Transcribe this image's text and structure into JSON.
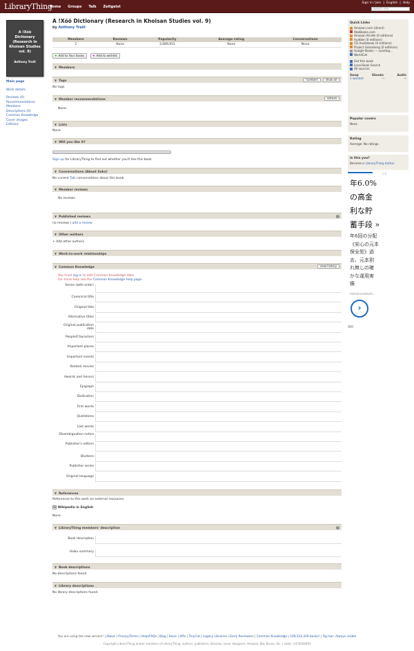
{
  "header": {
    "logo": "LibraryThing",
    "nav": [
      "Home",
      "Groups",
      "Talk",
      "Zeitgeist"
    ],
    "links": [
      "Sign in / Join",
      "English",
      "Help"
    ],
    "search_placeholder": "Search site"
  },
  "cover": {
    "title": "A !Xóõ Dictionary (Research in Khoisan Studies vol. 9)",
    "author": "Anthony Traill"
  },
  "leftnav": {
    "main_page": "Main page",
    "work_details": "Work details",
    "reviews": "Reviews (0)",
    "recommendations": "Recommendations",
    "members": "Members",
    "descriptions": "Descriptions (0)",
    "common_knowledge": "Common Knowledge",
    "cover_images": "Cover images",
    "editions": "Editions"
  },
  "book": {
    "title": "A !Xóõ Dictionary (Research in Khoisan Studies vol. 9)",
    "by": "by",
    "author": "Anthony Traill"
  },
  "stats": {
    "headers": [
      "Members",
      "Reviews",
      "Popularity",
      "Average rating",
      "Conversations"
    ],
    "values": [
      "1",
      "None",
      "3,689,951",
      "None",
      "None"
    ]
  },
  "buttons": {
    "add_books": "Add to Your books",
    "add_wishlist": "Add to wishlist"
  },
  "sections": {
    "members": "Members",
    "tags": "Tags",
    "tags_numbers": "numbers",
    "tags_show_all": "show all",
    "no_tags": "No tags.",
    "member_recs": "Member recommendations",
    "refresh": "refresh",
    "none": "None.",
    "lists": "Lists",
    "lists_none": "None",
    "will_you_like": "Will you like it?",
    "signup_link": "Sign up",
    "signup_text": "for LibraryThing to find out whether you'll like this book.",
    "conversations": "Conversations (About links)",
    "conv_text_1": "No current",
    "conv_link": "Talk",
    "conv_text_2": "conversations about this book.",
    "member_reviews": "Member reviews",
    "no_reviews": "No reviews",
    "published_reviews": "Published reviews",
    "no_reviews_pub": "no reviews",
    "sep": "|",
    "add_review": "add a review",
    "other_authors": "Other authors",
    "add_other_authors": "+ Add other authors",
    "wtw": "Work-to-work relationships",
    "common_knowledge": "Common Knowledge",
    "view_history": "view history",
    "ck_must": "You must",
    "ck_login": "log in",
    "ck_edit": "to edit Common Knowledge data.",
    "ck_help_text": "For more help see the",
    "ck_help_link": "Common Knowledge help page.",
    "references": "References",
    "ref_text": "References to this work on external resources.",
    "wikipedia": "Wikipedia in English",
    "wiki_none": "None",
    "lt_desc": "LibraryThing members' description",
    "book_description": "Book description",
    "haiku": "Haiku summary",
    "book_descs": "Book descriptions",
    "no_desc": "No descriptions found.",
    "library_descs": "Library descriptions",
    "no_lib_desc": "No library descriptions found."
  },
  "ck_fields": [
    "Series (with order)",
    "Canonical title",
    "Original title",
    "Alternative titles",
    "Original publication date",
    "People/Characters",
    "Important places",
    "Important events",
    "Related movies",
    "Awards and honors",
    "Epigraph",
    "Dedication",
    "First words",
    "Quotations",
    "Last words",
    "Disambiguation notice",
    "Publisher's editors",
    "Blurbers",
    "Publisher series",
    "Original language"
  ],
  "right": {
    "quick_links": "Quick Links",
    "links": [
      {
        "text": "Amazon.com (direct)",
        "icon": "amazon-icon",
        "color": "#e08a2a"
      },
      {
        "text": "AbeBooks.com",
        "icon": "abebooks-icon",
        "color": "#c0392b"
      },
      {
        "text": "Amazon Kindle (0 editions)",
        "icon": "kindle-icon",
        "color": "#e08a2a"
      },
      {
        "text": "Audible (0 editions)",
        "icon": "audible-icon",
        "color": "#e08a2a"
      },
      {
        "text": "CD Audiobook (0 editions)",
        "icon": "cd-icon",
        "color": "#e08a2a"
      },
      {
        "text": "Project Gutenberg (0 editions)",
        "icon": "gutenberg-icon",
        "color": "#e08a2a"
      },
      {
        "text": "Google Books — Loading...",
        "icon": "google-icon",
        "color": "#999999"
      },
      {
        "text": "WorldCat",
        "icon": "worldcat-icon",
        "color": "#3b6fb5"
      }
    ],
    "get_book": "Get this book",
    "local_search": "Local Book Search",
    "all_sources": "All sources",
    "swap_headers": [
      "Swap",
      "Ebooks",
      "Audio"
    ],
    "swap_values": [
      "1 wanted",
      "—",
      "—"
    ],
    "popular_covers": "Popular covers",
    "popular_none": "None",
    "rating": "Rating",
    "rating_text": "Average: No ratings.",
    "is_this_you": "Is this you?",
    "become_text": "Become a",
    "become_link": "LibraryThing Author."
  },
  "ad": {
    "lines_big": [
      "年6.0%",
      "の高金",
      "利な貯",
      "蓄手段 »"
    ],
    "lines_small": [
      "年6回の分配",
      "《安心の元本",
      "保全型》過",
      "去、元本割",
      "れ無しの確",
      "かな運用実",
      "績"
    ],
    "url": "mitsuiinvestsam...",
    "go": "›"
  },
  "footer": {
    "line1_prefix": "You are using the new servers!",
    "links": [
      "About",
      "Privacy/Terms",
      "Help/FAQs",
      "Blog",
      "Store",
      "APIs",
      "TinyCat",
      "Legacy Libraries",
      "Early Reviewers",
      "Common Knowledge",
      "109,524,416 books!",
      "Top bar: Always visible"
    ],
    "line2": "Copyright LibraryThing and/or members of LibraryThing, authors, publishers, libraries, cover designers, Amazon, Bol, Bruna, etc. | static: 1476266493"
  }
}
